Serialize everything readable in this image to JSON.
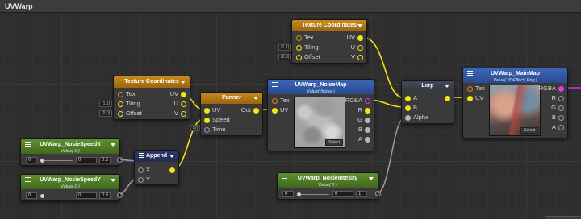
{
  "window": {
    "title": "UVWarp"
  },
  "nodes": {
    "texcoord_top": {
      "title": "Texture Coordinates",
      "in_tex": "Tex",
      "in_tiling": "Tiling",
      "in_offset": "Offset",
      "out_uv": "UV",
      "out_u": "U",
      "out_v": "V",
      "tag_tiling": "(1,1)",
      "tag_offset": "(0,0)"
    },
    "texcoord_left": {
      "title": "Texture Coordinates",
      "in_tex": "Tex",
      "in_tiling": "Tiling",
      "in_offset": "Offset",
      "out_uv": "UV",
      "out_u": "U",
      "out_v": "V",
      "tag_tiling": "(1,1)",
      "tag_offset": "(0,0)"
    },
    "panner": {
      "title": "Panner",
      "in_uv": "UV",
      "in_speed": "Speed",
      "in_time": "Time",
      "out": "Out",
      "tag_time": "(0)"
    },
    "noisemap": {
      "title": "UVWarp_NoiseMap",
      "subtitle": "Value( Noise )",
      "in_tex": "Tex",
      "in_uv": "UV",
      "out_rgba": "RGBA",
      "out_r": "R",
      "out_g": "G",
      "out_b": "B",
      "out_a": "A",
      "select": "Select"
    },
    "lerp": {
      "title": "Lerp",
      "in_a": "A",
      "in_b": "B",
      "in_alpha": "Alpha"
    },
    "mainmap": {
      "title": "UVWarp_MainMap",
      "subtitle": "Value( 2DEffect_Png )",
      "in_tex": "Tex",
      "in_uv": "UV",
      "out_rgba": "RGBA",
      "out_r": "R",
      "out_g": "G",
      "out_b": "B",
      "out_a": "A",
      "select": "Select"
    },
    "speed_x": {
      "title": "UVWarp_NosieSpeedX",
      "subtitle": "Value( 0 )",
      "min": "0",
      "max": "0.5",
      "value": "0",
      "slider_fraction": 0
    },
    "speed_y": {
      "title": "UVWarp_NosieSpeedY",
      "subtitle": "Value( 0 )",
      "min": "0",
      "max": "0.5",
      "value": "0",
      "slider_fraction": 0
    },
    "append": {
      "title": "Append",
      "in_x": "X",
      "in_y": "Y"
    },
    "intensity": {
      "title": "UVWarp_NosieIntesity",
      "subtitle": "Value( 0 )",
      "min": "0",
      "max": "1",
      "value": "0",
      "slider_fraction": 0
    }
  },
  "colors": {
    "wire": "#f2e318",
    "wire_gray": "#9a9a9a",
    "wire_magenta": "#d33bd3",
    "texcoord_header": "#b07716",
    "texture_header": "#3559a8",
    "float_header": "#4f7d27"
  }
}
